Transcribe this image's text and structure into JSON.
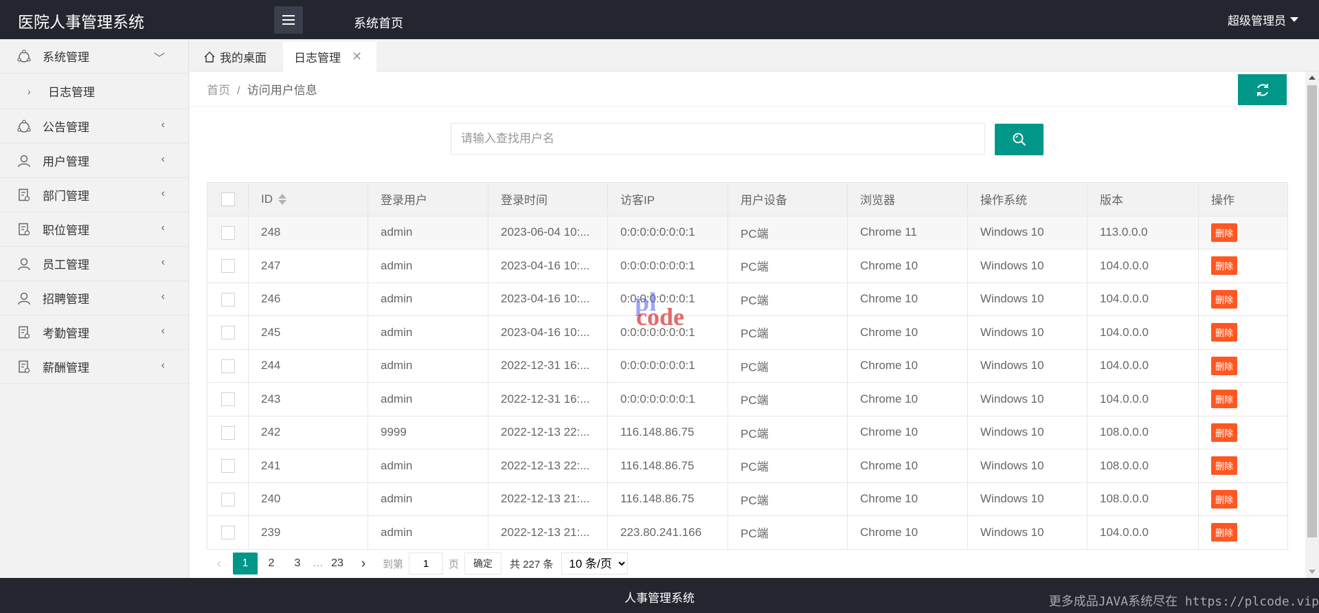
{
  "header": {
    "app_title": "医院人事管理系统",
    "home_link": "系统首页",
    "user_label": "超级管理员"
  },
  "sidebar": {
    "items": [
      {
        "label": "系统管理",
        "icon": "support-icon",
        "expanded": true
      },
      {
        "label": "公告管理",
        "icon": "support-icon"
      },
      {
        "label": "用户管理",
        "icon": "user-icon"
      },
      {
        "label": "部门管理",
        "icon": "document-icon"
      },
      {
        "label": "职位管理",
        "icon": "document-icon"
      },
      {
        "label": "员工管理",
        "icon": "user-icon"
      },
      {
        "label": "招聘管理",
        "icon": "user-icon"
      },
      {
        "label": "考勤管理",
        "icon": "document-icon"
      },
      {
        "label": "薪酬管理",
        "icon": "document-icon"
      }
    ],
    "sub_items": [
      {
        "label": "日志管理"
      }
    ]
  },
  "tabs": [
    {
      "label": "我的桌面",
      "icon": "home-icon"
    },
    {
      "label": "日志管理",
      "active": true
    }
  ],
  "breadcrumb": {
    "home": "首页",
    "separator": "/",
    "current": "访问用户信息"
  },
  "search": {
    "placeholder": "请输入查找用户名",
    "value": ""
  },
  "table": {
    "columns": [
      "ID",
      "登录用户",
      "登录时间",
      "访客IP",
      "用户设备",
      "浏览器",
      "操作系统",
      "版本",
      "操作"
    ],
    "delete_label": "删除",
    "rows": [
      {
        "id": "248",
        "user": "admin",
        "time": "2023-06-04 10:...",
        "ip": "0:0:0:0:0:0:0:1",
        "device": "PC端",
        "browser": "Chrome 11",
        "os": "Windows 10",
        "version": "113.0.0.0"
      },
      {
        "id": "247",
        "user": "admin",
        "time": "2023-04-16 10:...",
        "ip": "0:0:0:0:0:0:0:1",
        "device": "PC端",
        "browser": "Chrome 10",
        "os": "Windows 10",
        "version": "104.0.0.0"
      },
      {
        "id": "246",
        "user": "admin",
        "time": "2023-04-16 10:...",
        "ip": "0:0:0:0:0:0:0:1",
        "device": "PC端",
        "browser": "Chrome 10",
        "os": "Windows 10",
        "version": "104.0.0.0"
      },
      {
        "id": "245",
        "user": "admin",
        "time": "2023-04-16 10:...",
        "ip": "0:0:0:0:0:0:0:1",
        "device": "PC端",
        "browser": "Chrome 10",
        "os": "Windows 10",
        "version": "104.0.0.0"
      },
      {
        "id": "244",
        "user": "admin",
        "time": "2022-12-31 16:...",
        "ip": "0:0:0:0:0:0:0:1",
        "device": "PC端",
        "browser": "Chrome 10",
        "os": "Windows 10",
        "version": "104.0.0.0"
      },
      {
        "id": "243",
        "user": "admin",
        "time": "2022-12-31 16:...",
        "ip": "0:0:0:0:0:0:0:1",
        "device": "PC端",
        "browser": "Chrome 10",
        "os": "Windows 10",
        "version": "104.0.0.0"
      },
      {
        "id": "242",
        "user": "9999",
        "time": "2022-12-13 22:...",
        "ip": "116.148.86.75",
        "device": "PC端",
        "browser": "Chrome 10",
        "os": "Windows 10",
        "version": "108.0.0.0"
      },
      {
        "id": "241",
        "user": "admin",
        "time": "2022-12-13 22:...",
        "ip": "116.148.86.75",
        "device": "PC端",
        "browser": "Chrome 10",
        "os": "Windows 10",
        "version": "108.0.0.0"
      },
      {
        "id": "240",
        "user": "admin",
        "time": "2022-12-13 21:...",
        "ip": "116.148.86.75",
        "device": "PC端",
        "browser": "Chrome 10",
        "os": "Windows 10",
        "version": "108.0.0.0"
      },
      {
        "id": "239",
        "user": "admin",
        "time": "2022-12-13 21:...",
        "ip": "223.80.241.166",
        "device": "PC端",
        "browser": "Chrome 10",
        "os": "Windows 10",
        "version": "104.0.0.0"
      }
    ]
  },
  "pagination": {
    "pages": [
      "1",
      "2",
      "3"
    ],
    "ellipsis": "…",
    "last_page": "23",
    "goto_label": "到第",
    "goto_value": "1",
    "page_unit": "页",
    "confirm_label": "确定",
    "total_label": "共 227 条",
    "page_size": "10 条/页"
  },
  "footer": {
    "text": "人事管理系统",
    "watermark": "更多成品JAVA系统尽在 https://plcode.vip"
  },
  "watermark_logo": {
    "line1": "pl",
    "line2": "code"
  },
  "colors": {
    "header_bg": "#23262e",
    "accent": "#009688",
    "danger": "#ff5722"
  }
}
